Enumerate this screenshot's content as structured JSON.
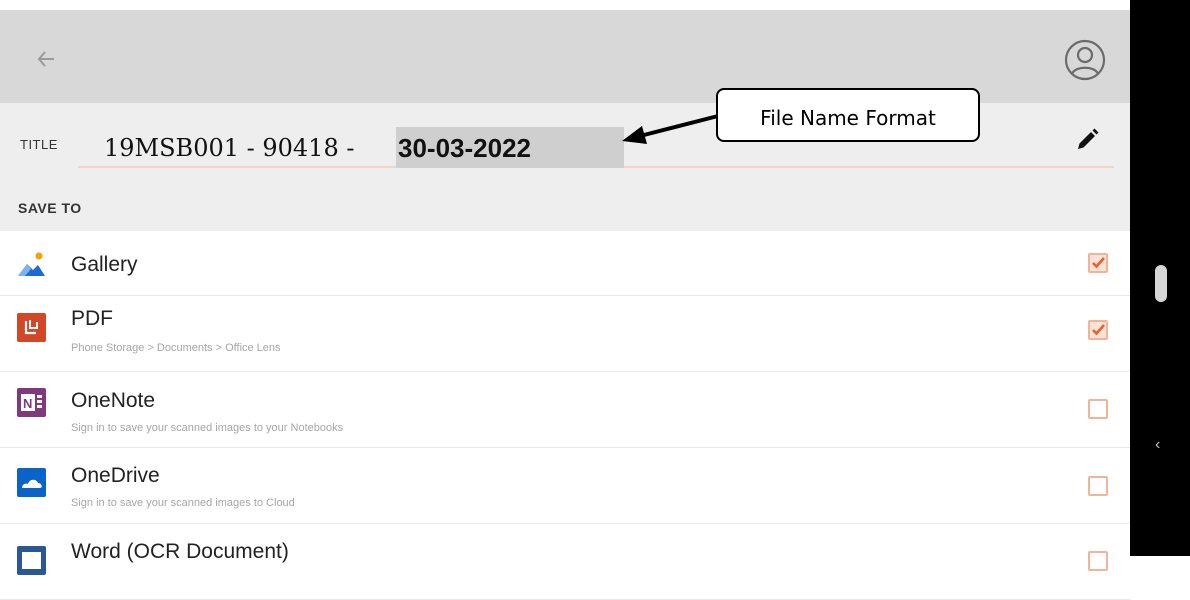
{
  "header": {
    "back_icon": "arrow-left-icon",
    "account_icon": "account-circle-icon"
  },
  "title": {
    "label": "TITLE",
    "value_prefix": "19MSB001 - 90418 -",
    "value_date": "30-03-2022",
    "edit_icon": "pencil-icon"
  },
  "save_to": {
    "label": "SAVE TO",
    "items": [
      {
        "name": "Gallery",
        "subtitle": "",
        "icon": "gallery-icon",
        "checked": true
      },
      {
        "name": "PDF",
        "subtitle": "Phone Storage > Documents > Office Lens",
        "icon": "pdf-icon",
        "checked": true
      },
      {
        "name": "OneNote",
        "subtitle": "Sign in to save your scanned images to your Notebooks",
        "icon": "onenote-icon",
        "checked": false
      },
      {
        "name": "OneDrive",
        "subtitle": "Sign in to save your scanned images to Cloud",
        "icon": "onedrive-icon",
        "checked": false
      },
      {
        "name": "Word (OCR Document)",
        "subtitle": "",
        "icon": "word-icon",
        "checked": false
      }
    ]
  },
  "annotation": {
    "callout_text": "File Name Format"
  },
  "colors": {
    "appbar": "#d8d8d8",
    "section_bg": "#eeeeee",
    "accent_orange": "#e8602c",
    "pdf_red": "#d24726",
    "onenote_purple": "#80397b",
    "onedrive_blue": "#0a64c8",
    "word_blue": "#2b5797"
  }
}
